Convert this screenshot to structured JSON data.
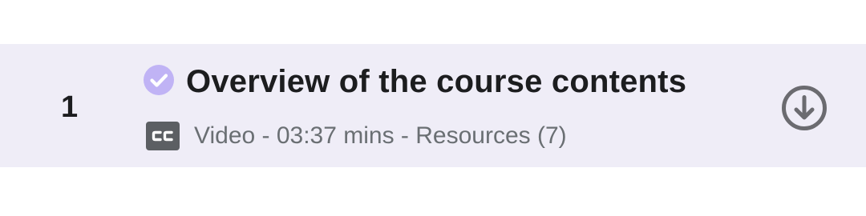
{
  "lecture": {
    "number": "1",
    "title": "Overview of the course contents",
    "meta": "Video - 03:37 mins - Resources (7)",
    "completed": true,
    "type_icon": "closed-captions-icon",
    "action_icon": "download-icon"
  },
  "colors": {
    "row_background": "#efedf7",
    "check_circle": "#c0b3f5",
    "title_text": "#1c1d1f",
    "meta_text": "#6a6f73",
    "icon_gray": "#6b6b70"
  }
}
